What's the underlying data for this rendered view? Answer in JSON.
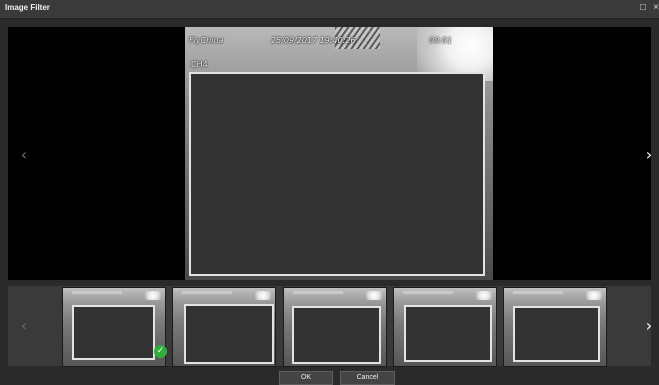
{
  "window": {
    "title": "Image Filter",
    "maximize_icon": "□",
    "close_icon": "×"
  },
  "viewer": {
    "prev_icon": "‹",
    "next_icon": "›",
    "osd_left": "FlyChina",
    "osd_datetime": "25/09/2017 19:40:26",
    "osd_right": "00:01",
    "osd_camera": "CH4"
  },
  "thumbnails": {
    "prev_icon": "‹",
    "next_icon": "›",
    "selected_index": 0,
    "check_icon": "✓"
  },
  "buttons": {
    "ok": "OK",
    "cancel": "Cancel"
  }
}
